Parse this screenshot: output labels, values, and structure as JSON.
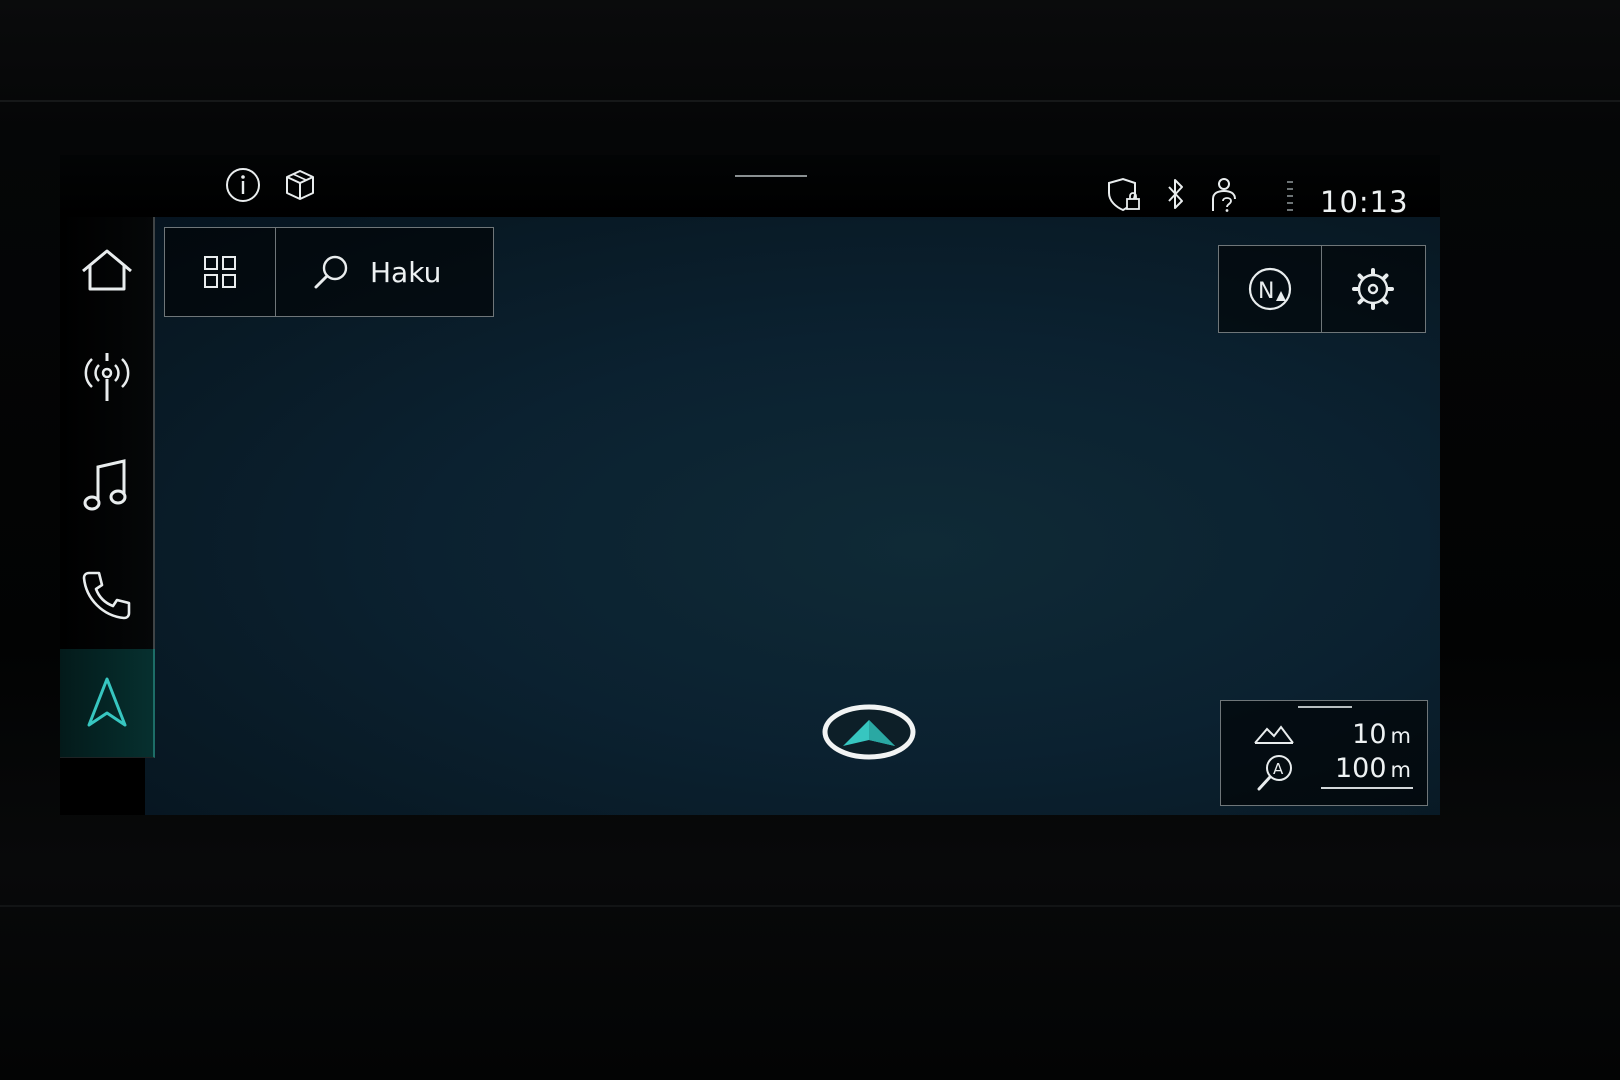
{
  "status_bar": {
    "time": "10:13",
    "icons": [
      "info-icon",
      "3d-box-icon",
      "shield-lock-icon",
      "bluetooth-icon",
      "user-help-icon",
      "signal-icon"
    ]
  },
  "sidebar": {
    "items": [
      {
        "id": "home",
        "icon": "home-icon"
      },
      {
        "id": "radio",
        "icon": "antenna-icon"
      },
      {
        "id": "music",
        "icon": "music-note-icon"
      },
      {
        "id": "phone",
        "icon": "phone-icon"
      },
      {
        "id": "navigation",
        "icon": "navigation-arrow-icon",
        "active": true
      }
    ]
  },
  "search": {
    "label": "Haku"
  },
  "map_controls": {
    "north_label": "N"
  },
  "scale": {
    "altitude_value": "10",
    "altitude_unit": "m",
    "zoom_value": "100",
    "zoom_unit": "m",
    "auto_label": "A"
  },
  "colors": {
    "accent": "#37c6c0",
    "map_background": "#0b2130",
    "border": "#6f7679"
  }
}
